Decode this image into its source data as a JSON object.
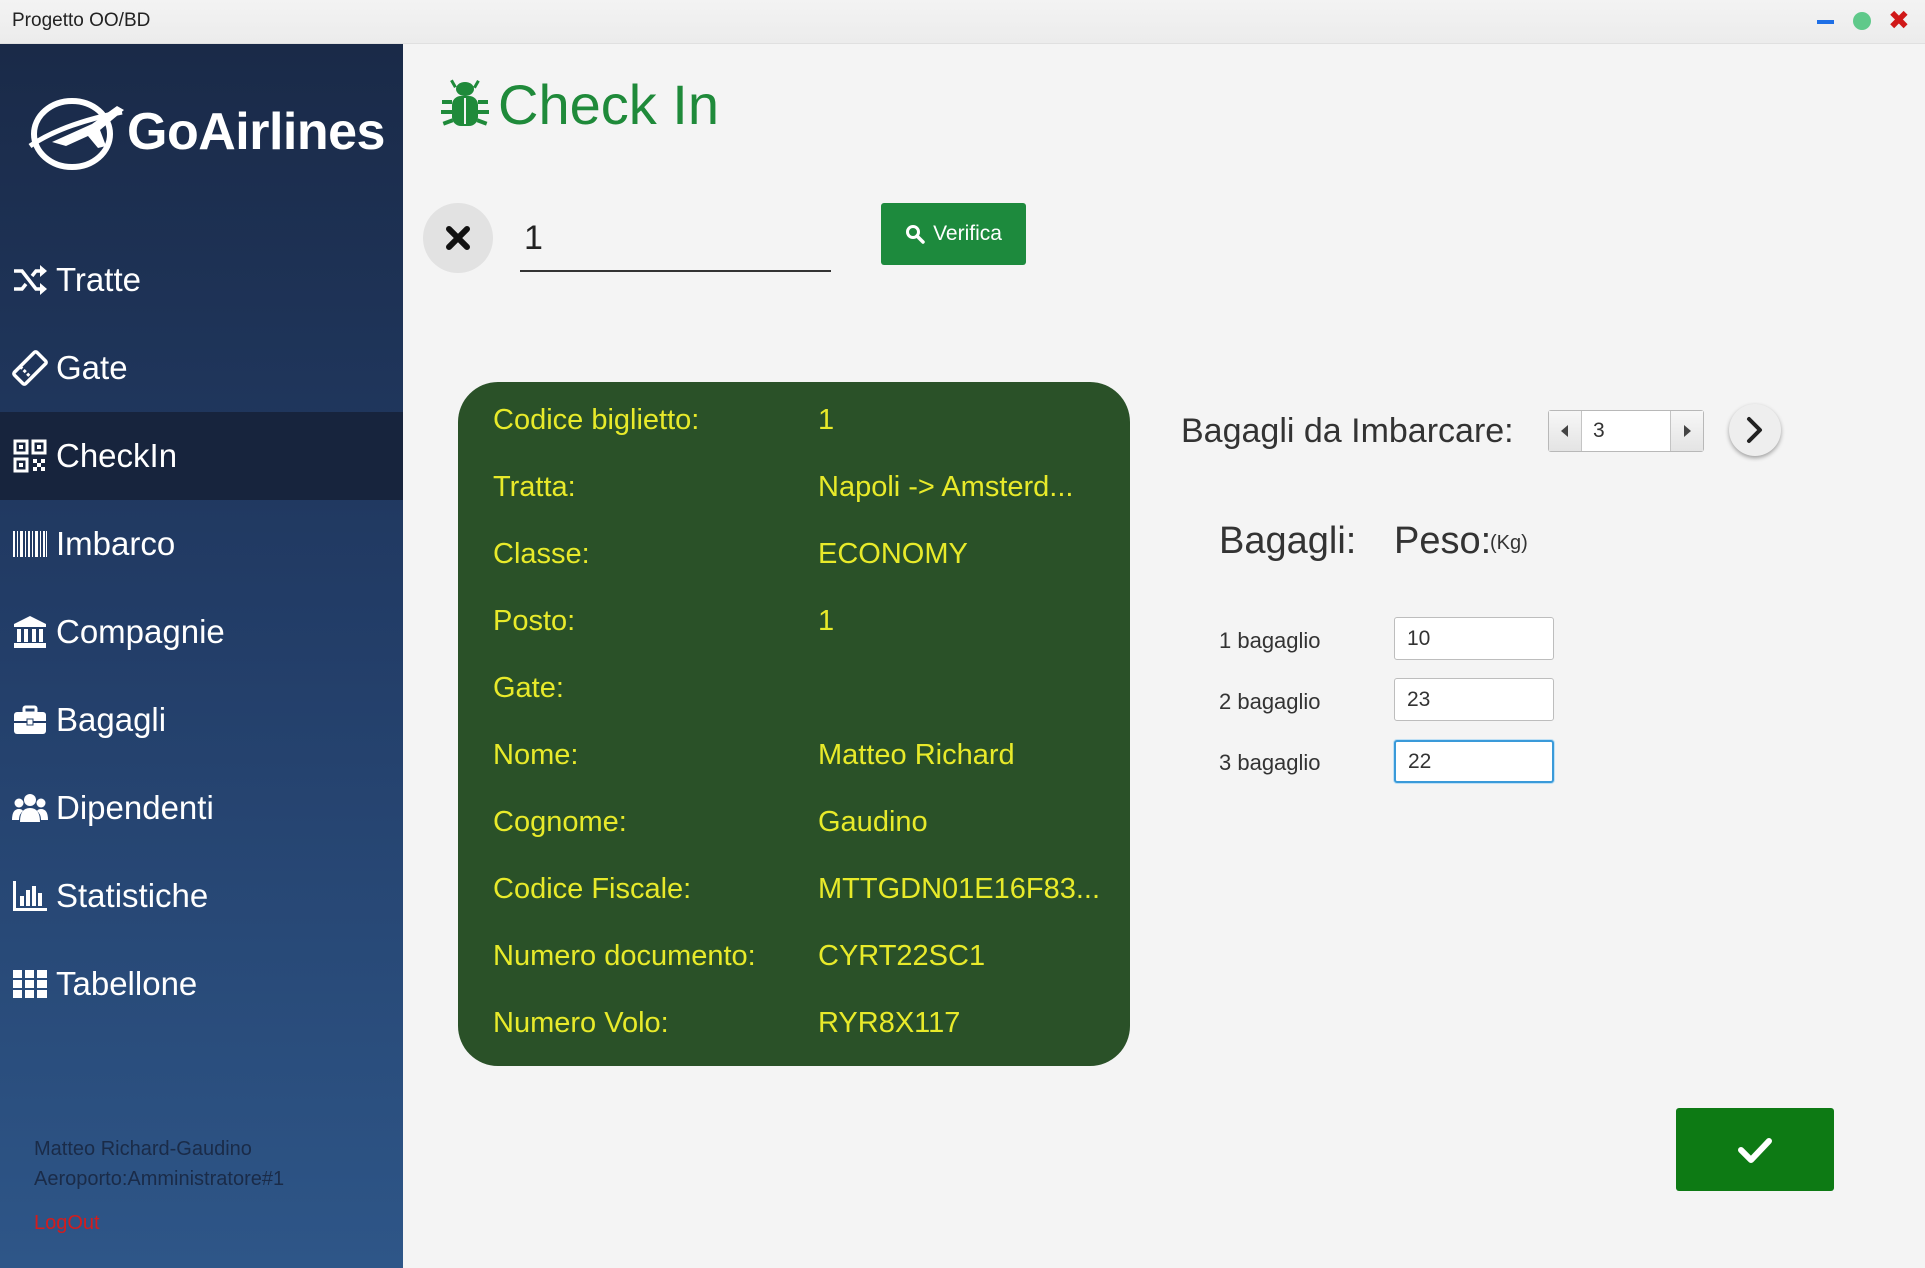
{
  "window": {
    "title": "Progetto OO/BD",
    "colors": {
      "minimize": "#1e6fe6",
      "maximize": "#5fc98a",
      "close": "#d01818"
    }
  },
  "sidebar": {
    "logo_text": "GoAirlines",
    "items": [
      {
        "label": "Tratte",
        "icon": "shuffle-icon"
      },
      {
        "label": "Gate",
        "icon": "ticket-icon"
      },
      {
        "label": "CheckIn",
        "icon": "qrcode-icon",
        "active": true
      },
      {
        "label": "Imbarco",
        "icon": "barcode-icon"
      },
      {
        "label": "Compagnie",
        "icon": "bank-icon"
      },
      {
        "label": "Bagagli",
        "icon": "briefcase-icon"
      },
      {
        "label": "Dipendenti",
        "icon": "users-icon"
      },
      {
        "label": "Statistiche",
        "icon": "bar-chart-icon"
      },
      {
        "label": "Tabellone",
        "icon": "grid-icon"
      }
    ],
    "user_name": "Matteo Richard-Gaudino",
    "user_role": "Aeroporto:Amministratore#1",
    "logout_label": "LogOut"
  },
  "header": {
    "title": "Check In"
  },
  "search": {
    "ticket_value": "1",
    "verify_label": "Verifica"
  },
  "ticket_info": [
    {
      "label": "Codice biglietto:",
      "value": "1"
    },
    {
      "label": "Tratta:",
      "value": "Napoli -> Amsterd..."
    },
    {
      "label": "Classe:",
      "value": "ECONOMY"
    },
    {
      "label": "Posto:",
      "value": "1"
    },
    {
      "label": "Gate:",
      "value": ""
    },
    {
      "label": "Nome:",
      "value": "Matteo Richard"
    },
    {
      "label": "Cognome:",
      "value": "Gaudino"
    },
    {
      "label": "Codice Fiscale:",
      "value": "MTTGDN01E16F83..."
    },
    {
      "label": "Numero documento:",
      "value": "CYRT22SC1"
    },
    {
      "label": "Numero Volo:",
      "value": "RYR8X117"
    }
  ],
  "baggage": {
    "count_label": "Bagagli da Imbarcare:",
    "count_value": "3",
    "header_bags": "Bagagli:",
    "header_weight": "Peso:",
    "header_unit": "(Kg)",
    "items": [
      {
        "label": "1 bagaglio",
        "weight": "10"
      },
      {
        "label": "2 bagaglio",
        "weight": "23"
      },
      {
        "label": "3 bagaglio",
        "weight": "22"
      }
    ]
  },
  "theme": {
    "card_bg": "#2a5128",
    "card_text": "#e8ea2a",
    "accent_green": "#1d8a3d",
    "confirm_green": "#0d7a14",
    "title_green": "#1f8a3a"
  }
}
